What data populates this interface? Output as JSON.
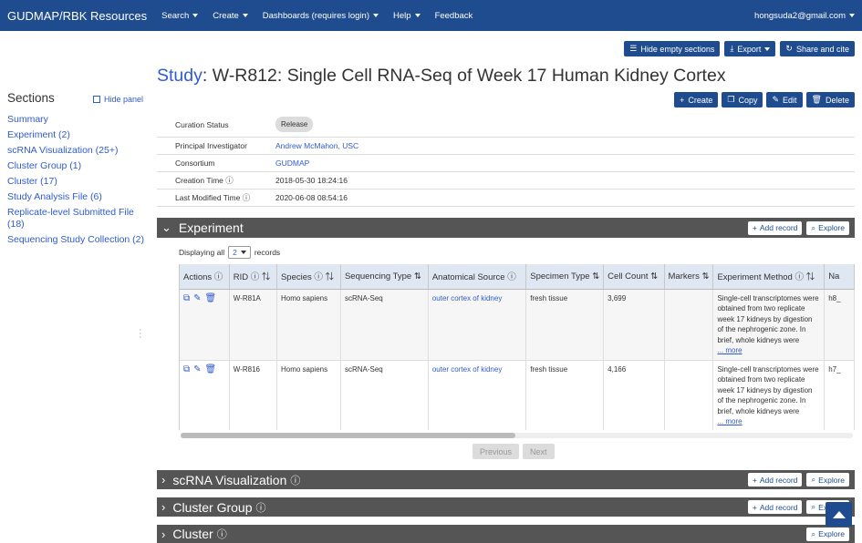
{
  "nav": {
    "brand": "GUDMAP/RBK Resources",
    "items": [
      "Search",
      "Create",
      "Dashboards (requires login)",
      "Help"
    ],
    "feedback": "Feedback",
    "user": "hongsuda2@gmail.com"
  },
  "top_actions": {
    "hide_empty": "Hide empty sections",
    "export": "Export",
    "share": "Share and cite"
  },
  "title": {
    "prefix": "Study",
    "text": ": W-R812: Single Cell RNA-Seq of Week 17 Human Kidney Cortex"
  },
  "title_actions": {
    "create": "Create",
    "copy": "Copy",
    "edit": "Edit",
    "delete": "Delete"
  },
  "sidebar": {
    "title": "Sections",
    "hide_panel": "Hide panel",
    "items": [
      "Summary",
      "Experiment (2)",
      "scRNA Visualization (25+)",
      "Cluster Group (1)",
      "Cluster (17)",
      "Study Analysis File (6)",
      "Replicate-level Submitted File (18)",
      "Sequencing Study Collection (2)"
    ]
  },
  "summary": {
    "curation_status": {
      "label": "Curation Status",
      "value": "Release"
    },
    "pi": {
      "label": "Principal Investigator",
      "value": "Andrew McMahon, USC"
    },
    "consortium": {
      "label": "Consortium",
      "value": "GUDMAP"
    },
    "creation_time": {
      "label": "Creation Time",
      "value": "2018-05-30 18:24:16"
    },
    "modified_time": {
      "label": "Last Modified Time",
      "value": "2020-06-08 08:54:16"
    }
  },
  "experiment": {
    "label": "Experiment",
    "add_record": "Add record",
    "explore": "Explore",
    "displaying": "Displaying all",
    "count": "2",
    "records": "records",
    "columns": [
      "Actions",
      "RID",
      "Species",
      "Sequencing Type",
      "Anatomical Source",
      "Specimen Type",
      "Cell Count",
      "Markers",
      "Experiment Method",
      "Na"
    ],
    "rows": [
      {
        "rid": "W-R81A",
        "species": "Homo sapiens",
        "seq_type": "scRNA-Seq",
        "source": "outer cortex of kidney",
        "specimen": "fresh tissue",
        "cell_count": "3,699",
        "markers": "",
        "method": "Single-cell transcriptomes were obtained from two replicate week 17 kidneys by digestion of the nephrogenic zone. In brief, whole kidneys were",
        "more": "... more",
        "na": "h8_"
      },
      {
        "rid": "W-R816",
        "species": "Homo sapiens",
        "seq_type": "scRNA-Seq",
        "source": "outer cortex of kidney",
        "specimen": "fresh tissue",
        "cell_count": "4,166",
        "markers": "",
        "method": "Single-cell transcriptomes were obtained from two replicate week 17 kidneys by digestion of the nephrogenic zone. In brief, whole kidneys were",
        "more": "... more",
        "na": "h7_"
      }
    ],
    "previous": "Previous",
    "next": "Next"
  },
  "sections": {
    "scrna": {
      "label": "scRNA Visualization",
      "add_record": "Add record",
      "explore": "Explore"
    },
    "cluster_group": {
      "label": "Cluster Group",
      "add_record": "Add record",
      "explore": "Explore"
    },
    "cluster": {
      "label": "Cluster",
      "explore": "Explore"
    }
  }
}
